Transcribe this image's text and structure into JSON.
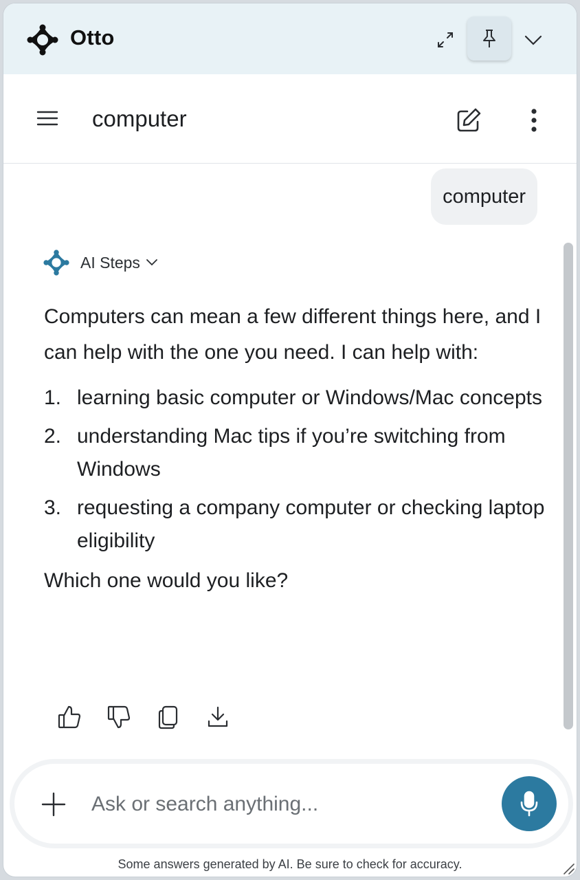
{
  "window": {
    "app_name": "Otto",
    "brand_color": "#111111",
    "accent_color": "#2c7aa0",
    "icons": [
      "otto-logo-icon",
      "expand-icon",
      "pin-icon",
      "chevron-down-icon"
    ]
  },
  "chat_header": {
    "title": "computer",
    "icons": [
      "menu-icon",
      "edit-icon",
      "more-vertical-icon"
    ]
  },
  "conversation": {
    "user_message": "computer",
    "ai_steps_label": "AI Steps",
    "answer_intro": "Computers can mean a few different things here, and I can help with the one you need. I can help with:",
    "options": [
      {
        "num": "1.",
        "text": "learning basic computer or Windows/Mac concepts"
      },
      {
        "num": "2.",
        "text": "understanding Mac tips if you’re switching from Windows"
      },
      {
        "num": "3.",
        "text": "requesting a company computer or checking laptop eligibility"
      }
    ],
    "answer_closing": "Which one would you like?",
    "feedback_icons": [
      "thumbs-up-icon",
      "thumbs-down-icon",
      "copy-icon",
      "download-icon"
    ]
  },
  "composer": {
    "placeholder": "Ask or search anything...",
    "icons": [
      "plus-icon",
      "microphone-icon"
    ]
  },
  "footer": {
    "disclaimer": "Some answers generated by AI. Be sure to check for accuracy."
  }
}
